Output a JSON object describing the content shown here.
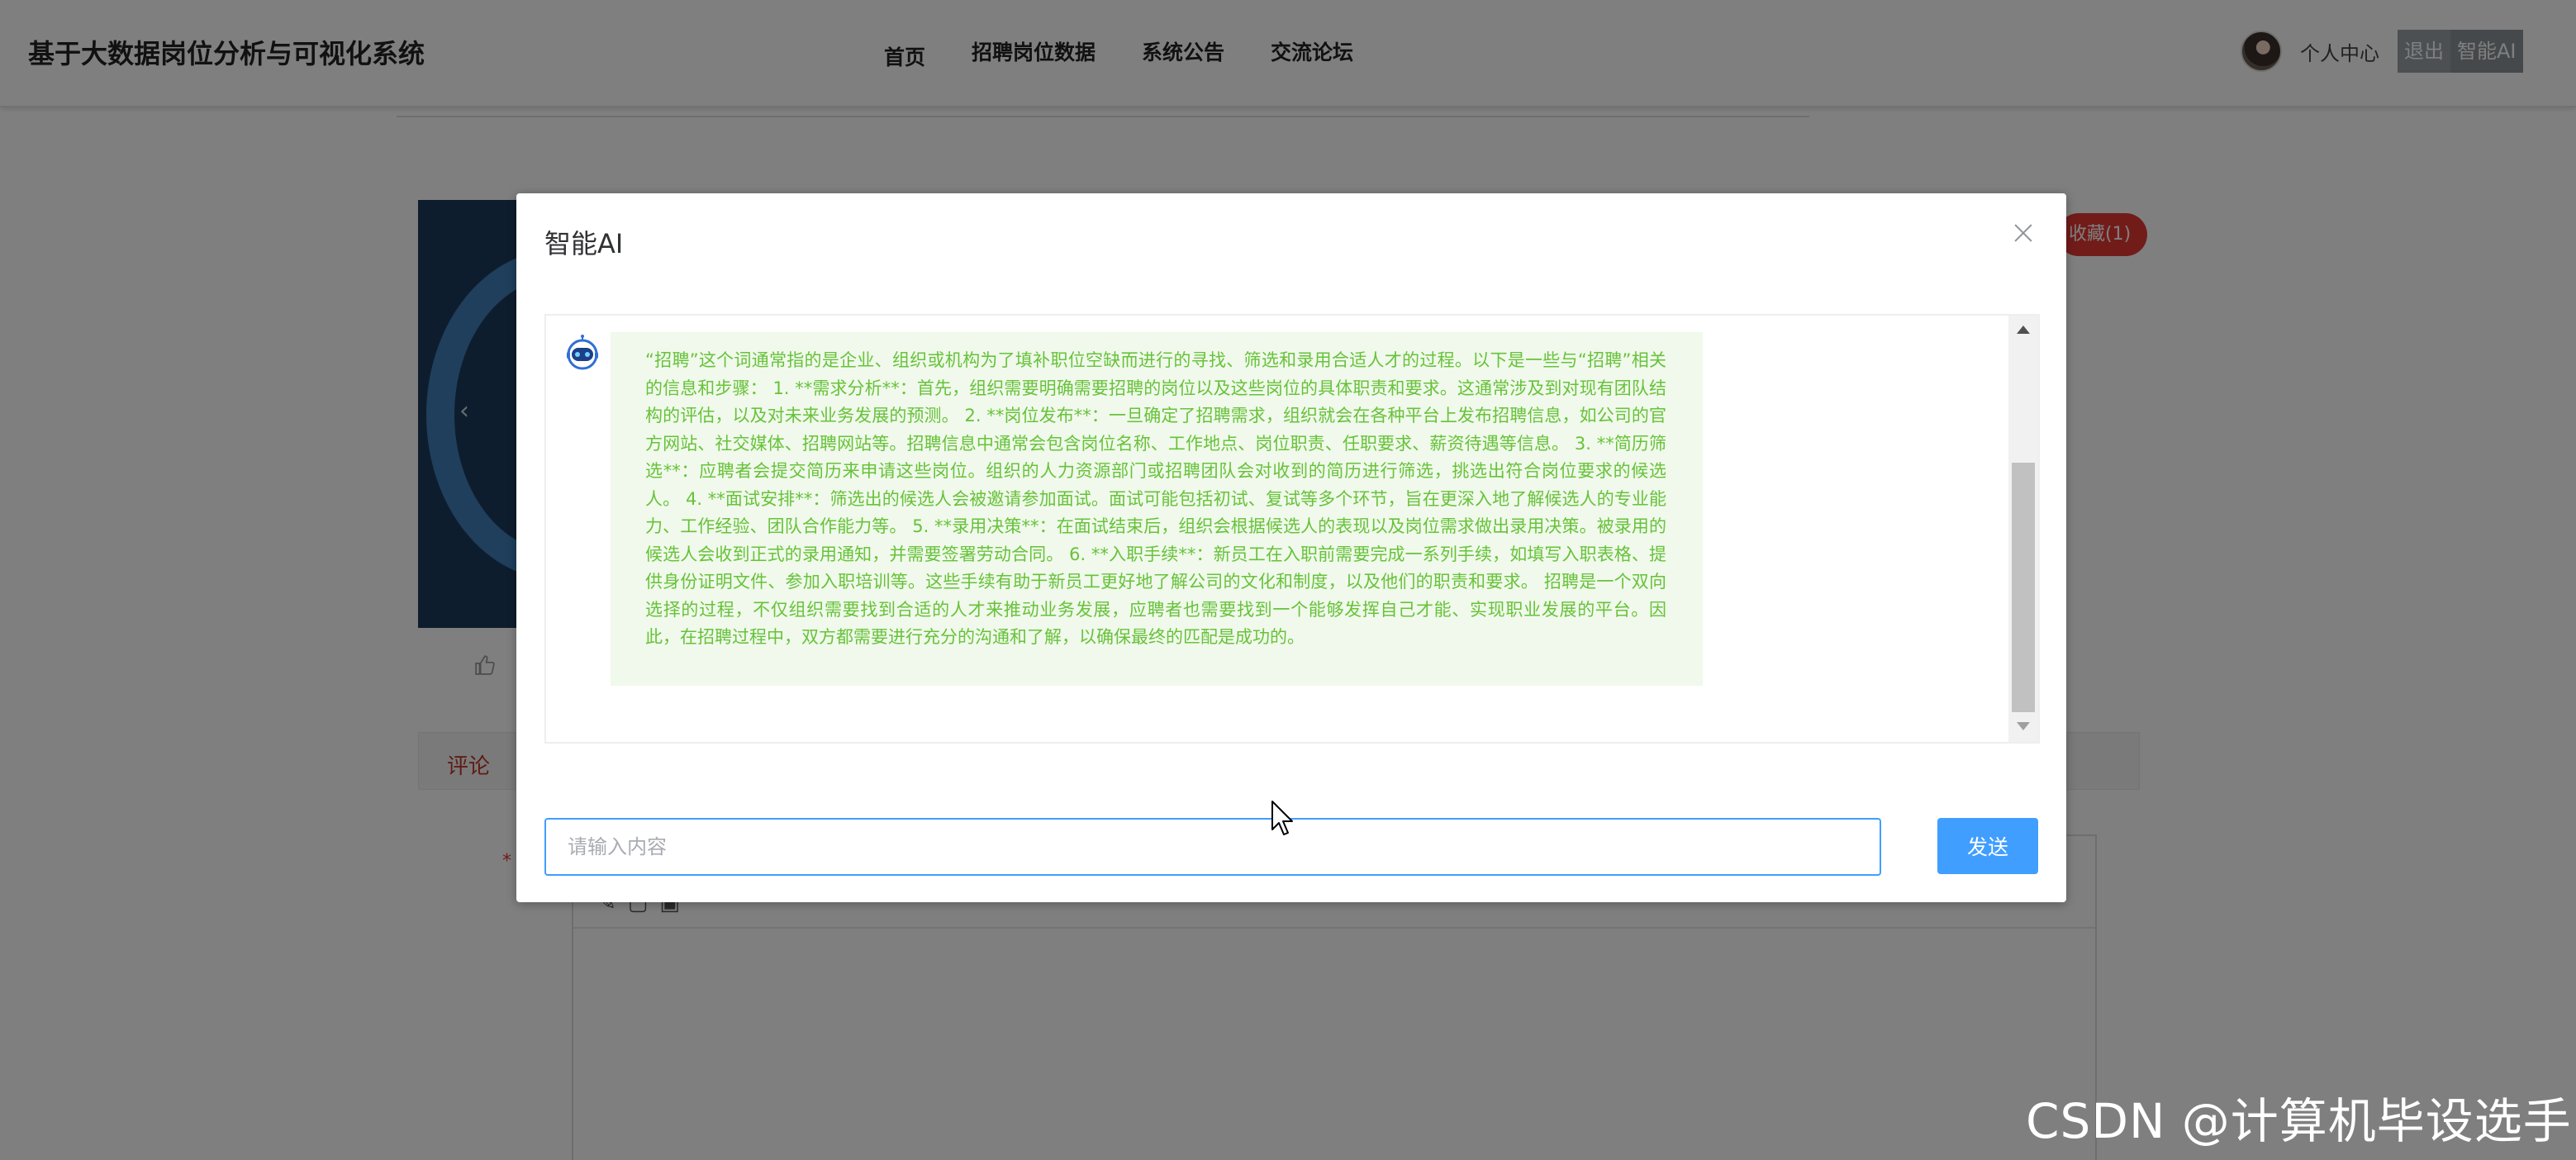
{
  "header": {
    "site_title": "基于大数据岗位分析与可视化系统",
    "nav": [
      {
        "label": "首页"
      },
      {
        "label": "招聘岗位数据"
      },
      {
        "label": "系统公告"
      },
      {
        "label": "交流论坛"
      }
    ],
    "user_center": "个人中心",
    "logout": "退出",
    "ai_button": "智能AI"
  },
  "page": {
    "favorite_badge": "收藏(1)",
    "comment_tab": "评论",
    "required_mark": "*"
  },
  "dialog": {
    "title": "智能AI",
    "message": "“招聘”这个词通常指的是企业、组织或机构为了填补职位空缺而进行的寻找、筛选和录用合适人才的过程。以下是一些与“招聘”相关的信息和步骤： 1. **需求分析**：首先，组织需要明确需要招聘的岗位以及这些岗位的具体职责和要求。这通常涉及到对现有团队结构的评估，以及对未来业务发展的预测。 2. **岗位发布**：一旦确定了招聘需求，组织就会在各种平台上发布招聘信息，如公司的官方网站、社交媒体、招聘网站等。招聘信息中通常会包含岗位名称、工作地点、岗位职责、任职要求、薪资待遇等信息。 3. **简历筛选**：应聘者会提交简历来申请这些岗位。组织的人力资源部门或招聘团队会对收到的简历进行筛选，挑选出符合岗位要求的候选人。 4. **面试安排**：筛选出的候选人会被邀请参加面试。面试可能包括初试、复试等多个环节，旨在更深入地了解候选人的专业能力、工作经验、团队合作能力等。 5. **录用决策**：在面试结束后，组织会根据候选人的表现以及岗位需求做出录用决策。被录用的候选人会收到正式的录用通知，并需要签署劳动合同。 6. **入职手续**：新员工在入职前需要完成一系列手续，如填写入职表格、提供身份证明文件、参加入职培训等。这些手续有助于新员工更好地了解公司的文化和制度，以及他们的职责和要求。 招聘是一个双向选择的过程，不仅组织需要找到合适的人才来推动业务发展，应聘者也需要找到一个能够发挥自己才能、实现职业发展的平台。因此，在招聘过程中，双方都需要进行充分的沟通和了解，以确保最终的匹配是成功的。",
    "input_placeholder": "请输入内容",
    "input_value": "",
    "send_label": "发送"
  },
  "watermark": "CSDN @计算机毕设选手",
  "colors": {
    "primary": "#409eff",
    "message_bg": "#f0f9eb",
    "message_text": "#67c23a",
    "favorite_badge": "#e53935",
    "overlay": "rgba(0,0,0,0.5)"
  },
  "icons": {
    "close": "close-icon",
    "bot_avatar": "robot-icon",
    "like": "thumbs-up-icon",
    "carousel_prev": "chevron-left-icon"
  }
}
